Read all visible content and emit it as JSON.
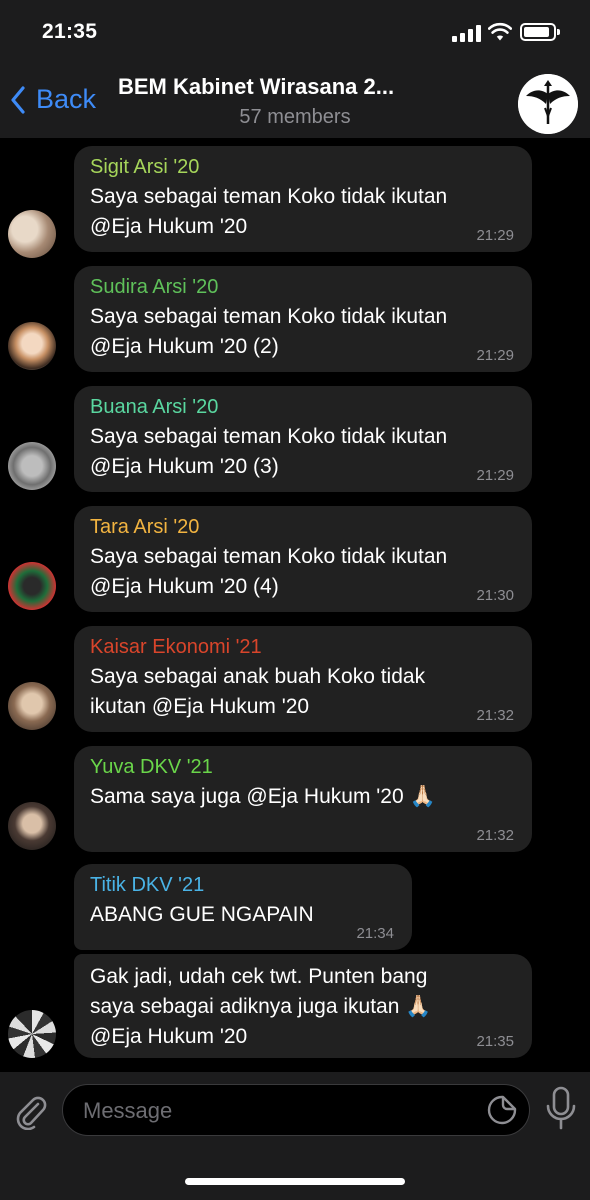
{
  "status_bar": {
    "time": "21:35"
  },
  "header": {
    "back_label": "Back",
    "title": "BEM Kabinet Wirasana 2...",
    "subtitle": "57 members"
  },
  "messages": [
    {
      "sender": "Sigit Arsi '20",
      "sender_color": "#a6d65b",
      "text": "Saya sebagai teman Koko tidak ikutan\n@Eja Hukum '20",
      "time": "21:29"
    },
    {
      "sender": "Sudira Arsi '20",
      "sender_color": "#5fc15a",
      "text": "Saya sebagai teman Koko tidak ikutan\n@Eja Hukum '20 (2)",
      "time": "21:29"
    },
    {
      "sender": "Buana Arsi '20",
      "sender_color": "#5ad7a0",
      "text": "Saya sebagai teman Koko tidak ikutan\n@Eja Hukum '20 (3)",
      "time": "21:29"
    },
    {
      "sender": "Tara Arsi '20",
      "sender_color": "#f2b441",
      "text": "Saya sebagai teman Koko tidak ikutan\n@Eja Hukum '20 (4)",
      "time": "21:30"
    },
    {
      "sender": "Kaisar Ekonomi '21",
      "sender_color": "#d9452b",
      "text": "Saya sebagai anak buah Koko tidak\nikutan @Eja Hukum '20",
      "time": "21:32"
    },
    {
      "sender": "Yuva DKV '21",
      "sender_color": "#6ad64a",
      "text": "Sama saya juga @Eja Hukum '20 🙏🏻",
      "time": "21:32"
    },
    {
      "sender": "Titik DKV '21",
      "sender_color": "#4ab3e6",
      "text": "ABANG GUE NGAPAIN",
      "time": "21:34"
    },
    {
      "sender": "",
      "sender_color": "#4ab3e6",
      "text": "Gak jadi, udah cek twt. Punten bang\nsaya sebagai adiknya juga ikutan 🙏🏻\n@Eja Hukum '20",
      "time": "21:35"
    }
  ],
  "input": {
    "placeholder": "Message"
  },
  "icons": {
    "back": "chevron-left-icon",
    "attach": "paperclip-icon",
    "sticker": "sticker-icon",
    "mic": "microphone-icon"
  },
  "colors": {
    "accent": "#3e8bf7",
    "bubble": "#212121",
    "background": "#000000"
  }
}
